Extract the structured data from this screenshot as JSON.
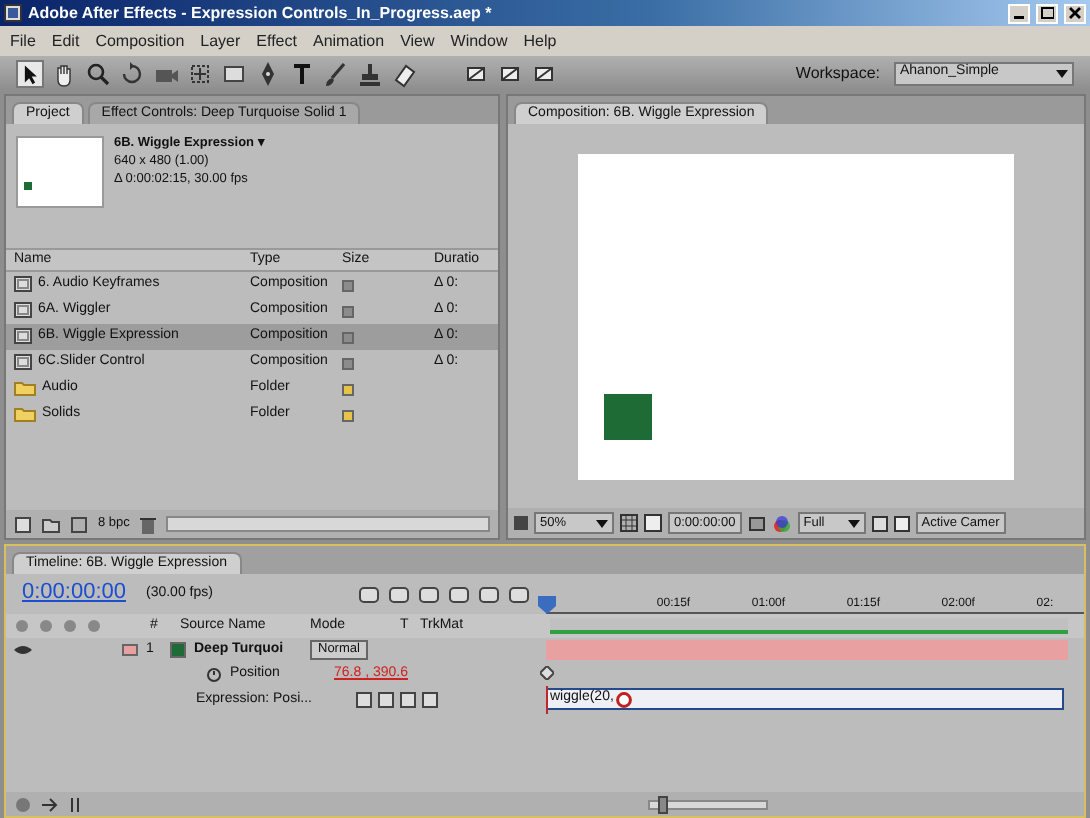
{
  "window": {
    "title": "Adobe After Effects - Expression Controls_In_Progress.aep *"
  },
  "menu": [
    "File",
    "Edit",
    "Composition",
    "Layer",
    "Effect",
    "Animation",
    "View",
    "Window",
    "Help"
  ],
  "workspace": {
    "label": "Workspace:",
    "value": "Ahanon_Simple"
  },
  "project_panel": {
    "tabs": [
      {
        "label": "Project",
        "selected": true
      },
      {
        "label": "Effect Controls: Deep Turquoise Solid 1",
        "selected": false
      }
    ],
    "info": {
      "name": "6B. Wiggle Expression ▾",
      "size": "640 x 480 (1.00)",
      "duration": "Δ 0:00:02:15, 30.00 fps"
    },
    "columns": [
      "Name",
      "Type",
      "Size",
      "Duratio"
    ],
    "rows": [
      {
        "kind": "composition",
        "name": "6. Audio Keyframes",
        "type": "Composition",
        "color": "#8c8c8c",
        "duration": "Δ 0:",
        "selected": false
      },
      {
        "kind": "composition",
        "name": "6A. Wiggler",
        "type": "Composition",
        "color": "#8c8c8c",
        "duration": "Δ 0:",
        "selected": false
      },
      {
        "kind": "composition",
        "name": "6B. Wiggle Expression",
        "type": "Composition",
        "color": "#8c8c8c",
        "duration": "Δ 0:",
        "selected": true
      },
      {
        "kind": "composition",
        "name": "6C.Slider Control",
        "type": "Composition",
        "color": "#8c8c8c",
        "duration": "Δ 0:",
        "selected": false
      },
      {
        "kind": "folder",
        "name": "Audio",
        "type": "Folder",
        "color": "#e8c34a",
        "selected": false
      },
      {
        "kind": "folder",
        "name": "Solids",
        "type": "Folder",
        "color": "#e8c34a",
        "selected": false
      }
    ],
    "bit_depth": "8 bpc"
  },
  "composition_panel": {
    "tab": "Composition: 6B. Wiggle Expression",
    "zoom": "50%",
    "timecode": "0:00:00:00",
    "resolution": "Full",
    "camera": "Active Camer"
  },
  "timeline": {
    "tab": "Timeline: 6B. Wiggle Expression",
    "timecode": "0:00:00:00",
    "fps": "(30.00 fps)",
    "columns": [
      "#",
      "Source Name",
      "Mode",
      "T",
      "TrkMat"
    ],
    "ruler": [
      "00:15f",
      "01:00f",
      "01:15f",
      "02:00f",
      "02:"
    ],
    "layer": {
      "number": "1",
      "name": "Deep Turquoi",
      "mode": "Normal",
      "color": "#e8a0a0",
      "source": {
        "color": "#1e6b35"
      }
    },
    "zoom_slider": {
      "level": 0.1
    },
    "property": {
      "name": "Position",
      "value": "76.8 , 390.6"
    },
    "expression": {
      "label": "Expression: Posi...",
      "code": "wiggle(20,"
    }
  }
}
